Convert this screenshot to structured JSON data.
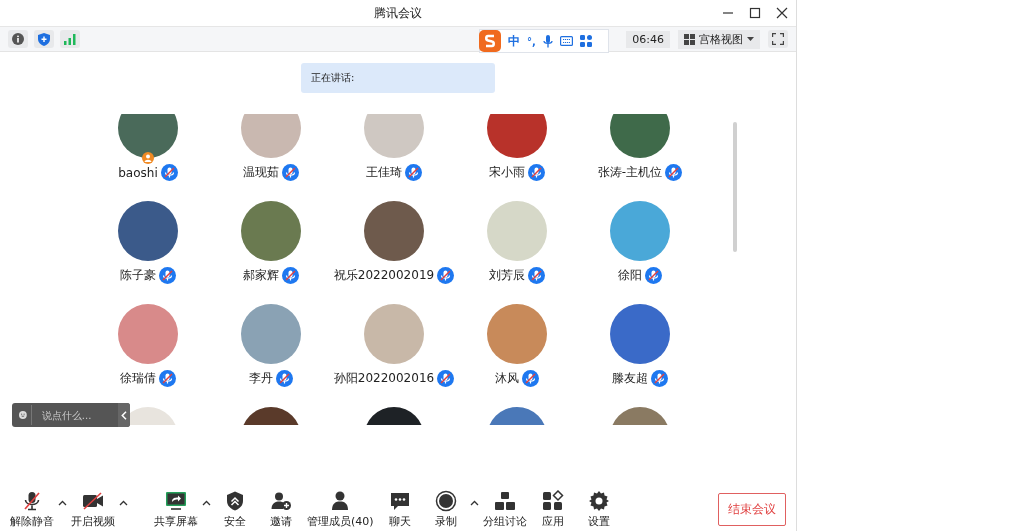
{
  "window": {
    "title": "腾讯会议"
  },
  "toolbar": {
    "time": "06:46",
    "view_label": "宫格视图"
  },
  "ime": {
    "mode": "中",
    "punct": "°,"
  },
  "speaking": {
    "label": "正在讲话:"
  },
  "participants": [
    {
      "name": "baoshi",
      "muted": true,
      "host": true,
      "color": "#4a6a5a"
    },
    {
      "name": "温现茹",
      "muted": true,
      "host": false,
      "color": "#c9b8b0"
    },
    {
      "name": "王佳琦",
      "muted": true,
      "host": false,
      "color": "#cfc8c2"
    },
    {
      "name": "宋小雨",
      "muted": true,
      "host": false,
      "color": "#b8322a"
    },
    {
      "name": "张涛-主机位",
      "muted": true,
      "host": false,
      "color": "#3f6a4a"
    },
    {
      "name": "陈子豪",
      "muted": true,
      "host": false,
      "color": "#3b5a8a"
    },
    {
      "name": "郝家辉",
      "muted": true,
      "host": false,
      "color": "#6a7a50"
    },
    {
      "name": "祝乐2022002019",
      "muted": true,
      "host": false,
      "color": "#6e5a4c"
    },
    {
      "name": "刘芳辰",
      "muted": true,
      "host": false,
      "color": "#d6d8c8"
    },
    {
      "name": "徐阳",
      "muted": true,
      "host": false,
      "color": "#4aa8d8"
    },
    {
      "name": "徐瑞倩",
      "muted": true,
      "host": false,
      "color": "#d88a8a"
    },
    {
      "name": "李丹",
      "muted": true,
      "host": false,
      "color": "#8aa2b4"
    },
    {
      "name": "孙阳2022002016",
      "muted": true,
      "host": false,
      "color": "#c8b8a8"
    },
    {
      "name": "沐风",
      "muted": true,
      "host": false,
      "color": "#c88a5a"
    },
    {
      "name": "滕友超",
      "muted": true,
      "host": false,
      "color": "#3a6ac8"
    },
    {
      "color": "#e8e4de"
    },
    {
      "color": "#5a3a2a"
    },
    {
      "color": "#1e2226"
    },
    {
      "color": "#4a78b8"
    },
    {
      "color": "#8a7a62"
    }
  ],
  "chat_input": {
    "placeholder": "说点什么..."
  },
  "bottom_bar": [
    {
      "kind": "mic",
      "label": "解除静音",
      "caret": true
    },
    {
      "kind": "video",
      "label": "开启视频",
      "caret": true
    },
    {
      "kind": "share",
      "label": "共享屏幕",
      "caret": true
    },
    {
      "kind": "security",
      "label": "安全",
      "caret": false
    },
    {
      "kind": "invite",
      "label": "邀请",
      "caret": false
    },
    {
      "kind": "members",
      "label": "管理成员(40)",
      "caret": false
    },
    {
      "kind": "chat",
      "label": "聊天",
      "caret": false
    },
    {
      "kind": "record",
      "label": "录制",
      "caret": true
    },
    {
      "kind": "breakout",
      "label": "分组讨论",
      "caret": false
    },
    {
      "kind": "apps",
      "label": "应用",
      "caret": false
    },
    {
      "kind": "settings",
      "label": "设置",
      "caret": false
    }
  ],
  "end_button": "结束会议"
}
